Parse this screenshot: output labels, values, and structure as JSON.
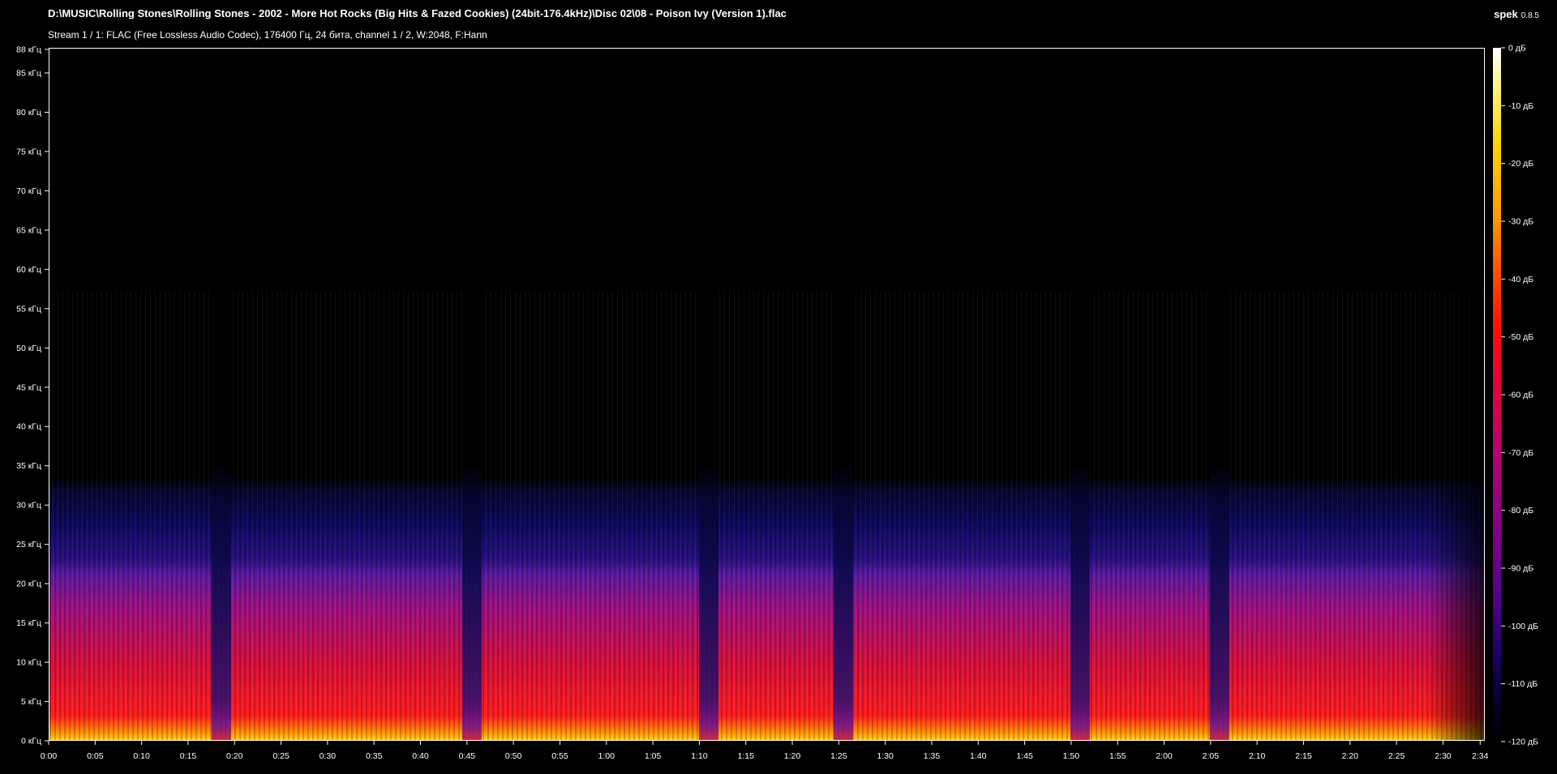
{
  "window": {
    "title": "D:\\MUSIC\\Rolling Stones\\Rolling Stones - 2002 - More Hot Rocks (Big Hits & Fazed Cookies) (24bit-176.4kHz)\\Disc 02\\08 - Poison Ivy (Version 1).flac",
    "stream_info": "Stream 1 / 1: FLAC (Free Lossless Audio Codec), 176400 Гц, 24 бита, channel 1 / 2, W:2048, F:Hann",
    "app_name": "spek",
    "app_version": "0.8.5"
  },
  "frequency_axis": {
    "labels": [
      "88 кГц",
      "85 кГц",
      "80 кГц",
      "75 кГц",
      "70 кГц",
      "65 кГц",
      "60 кГц",
      "55 кГц",
      "50 кГц",
      "45 кГц",
      "40 кГц",
      "35 кГц",
      "30 кГц",
      "25 кГц",
      "20 кГц",
      "15 кГц",
      "10 кГц",
      "5 кГц",
      "0 кГц"
    ],
    "values_khz": [
      88,
      85,
      80,
      75,
      70,
      65,
      60,
      55,
      50,
      45,
      40,
      35,
      30,
      25,
      20,
      15,
      10,
      5,
      0
    ],
    "max_khz": 88.2
  },
  "time_axis": {
    "labels": [
      "0:00",
      "0:05",
      "0:10",
      "0:15",
      "0:20",
      "0:25",
      "0:30",
      "0:35",
      "0:40",
      "0:45",
      "0:50",
      "0:55",
      "1:00",
      "1:05",
      "1:10",
      "1:15",
      "1:20",
      "1:25",
      "1:30",
      "1:35",
      "1:40",
      "1:45",
      "1:50",
      "1:55",
      "2:00",
      "2:05",
      "2:10",
      "2:15",
      "2:20",
      "2:25",
      "2:30",
      "2:34"
    ],
    "values_s": [
      0,
      5,
      10,
      15,
      20,
      25,
      30,
      35,
      40,
      45,
      50,
      55,
      60,
      65,
      70,
      75,
      80,
      85,
      90,
      95,
      100,
      105,
      110,
      115,
      120,
      125,
      130,
      135,
      140,
      145,
      150,
      154
    ],
    "duration_s": 154.5
  },
  "colorbar": {
    "labels": [
      "0 дБ",
      "-10 дБ",
      "-20 дБ",
      "-30 дБ",
      "-40 дБ",
      "-50 дБ",
      "-60 дБ",
      "-70 дБ",
      "-80 дБ",
      "-90 дБ",
      "-100 дБ",
      "-110 дБ",
      "-120 дБ"
    ],
    "values_db": [
      0,
      -10,
      -20,
      -30,
      -40,
      -50,
      -60,
      -70,
      -80,
      -90,
      -100,
      -110,
      -120
    ]
  },
  "spectrogram": {
    "content_ceiling_khz": 33,
    "gap_times_s": [
      18.5,
      45.5,
      71,
      85.5,
      111,
      126
    ]
  },
  "colors": {
    "background": "#000000",
    "text": "#ffffff",
    "deep_blue": "#0a0a5a",
    "purple": "#5a1a9e",
    "magenta": "#b0108a",
    "red": "#e81428",
    "orange": "#ff7a00",
    "yellow": "#ffd21e"
  }
}
